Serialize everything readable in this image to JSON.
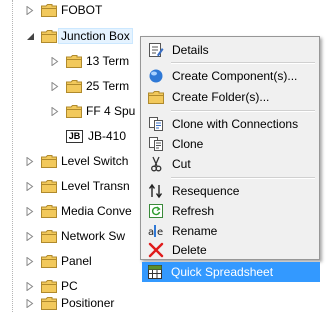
{
  "tree": {
    "items": [
      {
        "label": "FOBOT",
        "type": "folder",
        "expanded": false
      },
      {
        "label": "Junction Box",
        "type": "folder",
        "expanded": true
      },
      {
        "label": "13 Term",
        "type": "folder",
        "expanded": false
      },
      {
        "label": "25 Term",
        "type": "folder",
        "expanded": false
      },
      {
        "label": "FF 4 Spu",
        "type": "folder",
        "expanded": false
      },
      {
        "label": "JB-410",
        "type": "item",
        "badge": "JB"
      },
      {
        "label": "Level Switch",
        "type": "folder",
        "expanded": false
      },
      {
        "label": "Level Transn",
        "type": "folder",
        "expanded": false
      },
      {
        "label": "Media Conve",
        "type": "folder",
        "expanded": false
      },
      {
        "label": "Network Sw",
        "type": "folder",
        "expanded": false
      },
      {
        "label": "Panel",
        "type": "folder",
        "expanded": false
      },
      {
        "label": "PC",
        "type": "folder",
        "expanded": false
      },
      {
        "label": "Positioner",
        "type": "folder",
        "expanded": false
      }
    ]
  },
  "context_menu": {
    "items": [
      {
        "label": "Details",
        "icon": "details-icon"
      },
      {
        "label": "Create Component(s)...",
        "icon": "create-component-icon"
      },
      {
        "label": "Create Folder(s)...",
        "icon": "create-folder-icon"
      },
      {
        "label": "Clone with Connections",
        "icon": "clone-with-connections-icon"
      },
      {
        "label": "Clone",
        "icon": "clone-icon"
      },
      {
        "label": "Cut",
        "icon": "scissors-icon"
      },
      {
        "label": "Resequence",
        "icon": "resequence-icon"
      },
      {
        "label": "Refresh",
        "icon": "refresh-icon"
      },
      {
        "label": "Rename",
        "icon": "rename-icon"
      },
      {
        "label": "Delete",
        "icon": "delete-icon"
      },
      {
        "label": "Quick Spreadsheet",
        "icon": "spreadsheet-icon",
        "highlighted": true
      }
    ]
  },
  "colors": {
    "folder": "#e8b84a",
    "highlight": "#3399ff",
    "menu_bg": "#f0f0f0",
    "delete_red": "#e01b1b"
  }
}
